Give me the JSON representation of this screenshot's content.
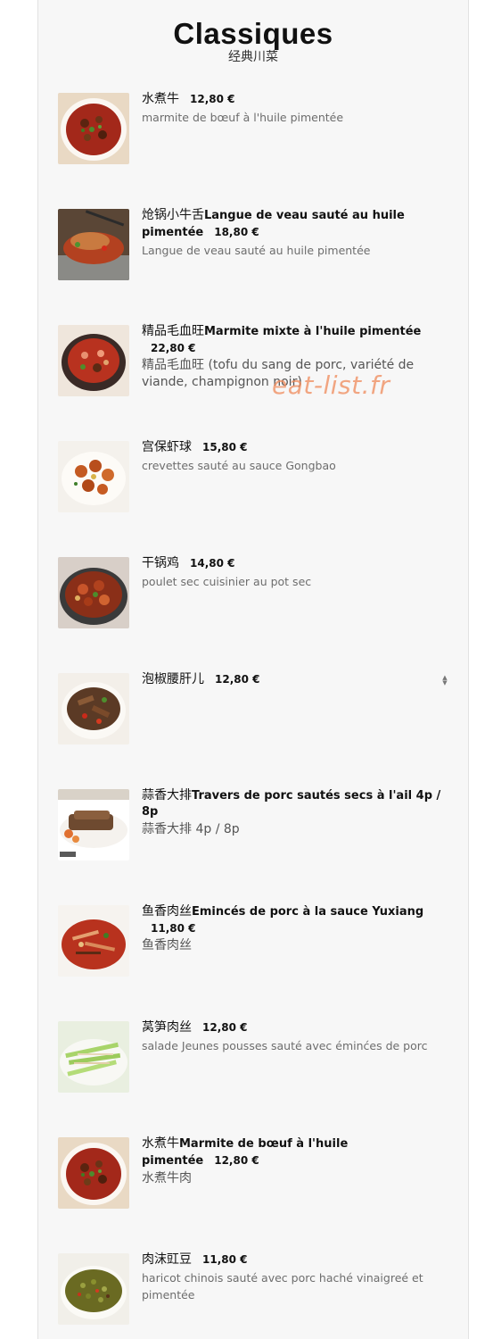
{
  "header": {
    "title": "Classiques",
    "subtitle": "经典川菜"
  },
  "watermark": "eat-list.fr",
  "items": [
    {
      "zh": "水煮牛",
      "fr": "",
      "price": "12,80 €",
      "desc": "marmite de bœuf à l'huile pimentée",
      "image": "boiled-beef-icon"
    },
    {
      "zh": "炝锅小牛舌",
      "fr": "Langue de veau sauté au huile pimentée",
      "price": "18,80 €",
      "desc": "Langue de veau sauté au huile pimentée",
      "image": "veal-tongue-icon"
    },
    {
      "zh": "精品毛血旺",
      "fr": "Marmite mixte à l'huile pimentée",
      "price": "22,80 €",
      "desc": "精品毛血旺 (tofu du sang de porc, variété de viande, champignon noir)",
      "image": "mixed-pot-icon"
    },
    {
      "zh": "宫保虾球",
      "fr": "",
      "price": "15,80 €",
      "desc": "crevettes sauté au sauce Gongbao",
      "image": "shrimp-icon"
    },
    {
      "zh": "干锅鸡",
      "fr": "",
      "price": "14,80 €",
      "desc": "poulet sec cuisinier au pot sec",
      "image": "chicken-pot-icon"
    },
    {
      "zh": "泡椒腰肝儿",
      "fr": "",
      "price": "12,80 €",
      "desc": "",
      "image": "kidney-liver-icon"
    },
    {
      "zh": "蒜香大排",
      "fr": "Travers de porc sautés secs à l'ail 4p / 8p",
      "price": "",
      "desc": "蒜香大排 4p / 8p",
      "image": "pork-ribs-icon"
    },
    {
      "zh": "鱼香肉丝",
      "fr": "Emincés de porc à la sauce Yuxiang",
      "price": "11,80 €",
      "desc": "鱼香肉丝",
      "image": "yuxiang-pork-icon"
    },
    {
      "zh": "莴笋肉丝",
      "fr": "",
      "price": "12,80 €",
      "desc": "salade Jeunes pousses sauté avec éminćes de porc",
      "image": "lettuce-pork-icon"
    },
    {
      "zh": "水煮牛",
      "fr": "Marmite de bœuf à l'huile pimentée",
      "price": "12,80 €",
      "desc": "水煮牛肉",
      "image": "boiled-beef-2-icon"
    },
    {
      "zh": "肉沫豇豆",
      "fr": "",
      "price": "11,80 €",
      "desc": "haricot chinois sauté avec porc haché vinaigreé et pimentée",
      "image": "long-beans-icon"
    }
  ]
}
